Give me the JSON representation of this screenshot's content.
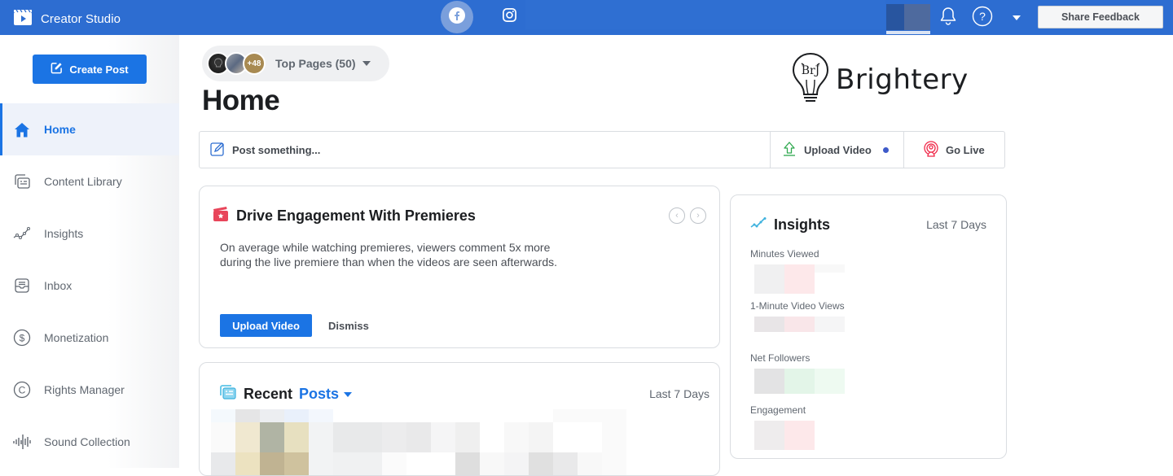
{
  "topbar": {
    "app_title": "Creator Studio",
    "app_icon": "clapperboard-play-icon",
    "platforms": [
      {
        "name": "Facebook",
        "icon": "facebook-icon",
        "active": true
      },
      {
        "name": "Instagram",
        "icon": "instagram-icon",
        "active": false
      }
    ],
    "notifications_icon": "bell-icon",
    "help_icon": "help-circle-icon",
    "menu_icon": "caret-down-icon",
    "share_feedback_label": "Share Feedback"
  },
  "sidebar": {
    "create_post_label": "Create Post",
    "items": [
      {
        "label": "Home",
        "icon": "home-icon",
        "active": true
      },
      {
        "label": "Content Library",
        "icon": "content-library-icon",
        "active": false
      },
      {
        "label": "Insights",
        "icon": "insights-icon",
        "active": false
      },
      {
        "label": "Inbox",
        "icon": "inbox-icon",
        "active": false
      },
      {
        "label": "Monetization",
        "icon": "dollar-circle-icon",
        "active": false
      },
      {
        "label": "Rights Manager",
        "icon": "copyright-icon",
        "active": false
      },
      {
        "label": "Sound Collection",
        "icon": "sound-wave-icon",
        "active": false
      }
    ]
  },
  "main": {
    "page_selector": {
      "label": "Top Pages (50)",
      "extra_count": "+48"
    },
    "title": "Home",
    "brand_logo_text": "Brightery",
    "composer": {
      "post_placeholder": "Post something...",
      "upload_label": "Upload Video",
      "go_live_label": "Go Live"
    },
    "premiere_card": {
      "title": "Drive Engagement With Premieres",
      "body": "On average while watching premieres, viewers comment 5x more during the live premiere than when the videos are seen afterwards.",
      "primary_button": "Upload Video",
      "secondary_button": "Dismiss",
      "prev_glyph": "‹",
      "next_glyph": "›"
    },
    "recent_card": {
      "title": "Recent",
      "filter_label": "Posts",
      "range": "Last 7 Days"
    },
    "insights_card": {
      "title": "Insights",
      "range": "Last 7 Days",
      "metrics": [
        {
          "label": "Minutes Viewed",
          "trend_color": "#fde8ea"
        },
        {
          "label": "1-Minute Video Views",
          "trend_color": "#f9e6e9"
        },
        {
          "label": "Net Followers",
          "trend_color": "#e3f5e8"
        },
        {
          "label": "Engagement",
          "trend_color": "#fde8ea"
        }
      ]
    }
  },
  "colors": {
    "topbar": "#2d6dd1",
    "accent": "#1b74e4",
    "text_secondary": "#606770"
  }
}
